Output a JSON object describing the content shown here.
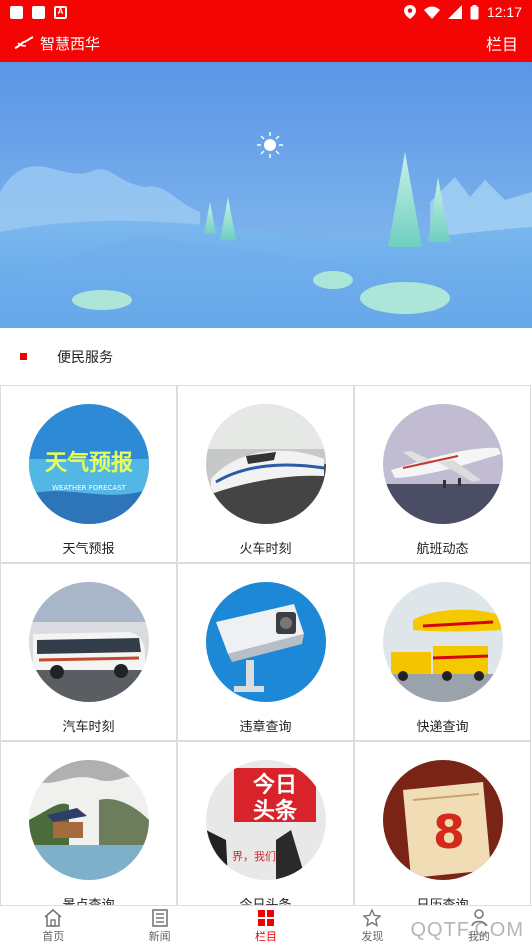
{
  "status_bar": {
    "time": "12:17",
    "notif_letter": "A"
  },
  "app_bar": {
    "title": "智慧西华",
    "menu_label": "栏目"
  },
  "section": {
    "title": "便民服务"
  },
  "services": [
    {
      "label": "天气预报",
      "image_caption": "天气预报",
      "image_subcaption": "WEATHER FORECAST"
    },
    {
      "label": "火车时刻"
    },
    {
      "label": "航班动态"
    },
    {
      "label": "汽车时刻"
    },
    {
      "label": "违章查询"
    },
    {
      "label": "快递查询"
    },
    {
      "label": "景点查询"
    },
    {
      "label": "今日头条",
      "image_caption_1": "今日",
      "image_caption_2": "头条",
      "image_caption_3": "界，我们"
    },
    {
      "label": "日历查询",
      "image_number": "8"
    }
  ],
  "tabs": [
    {
      "label": "首页",
      "icon": "home-icon"
    },
    {
      "label": "新闻",
      "icon": "news-icon"
    },
    {
      "label": "栏目",
      "icon": "grid-icon",
      "active": true
    },
    {
      "label": "发现",
      "icon": "star-icon"
    },
    {
      "label": "我的",
      "icon": "user-icon"
    }
  ],
  "watermark": "QQTF.COM",
  "colors": {
    "brand_red": "#f50404",
    "accent_red": "#e00000"
  }
}
